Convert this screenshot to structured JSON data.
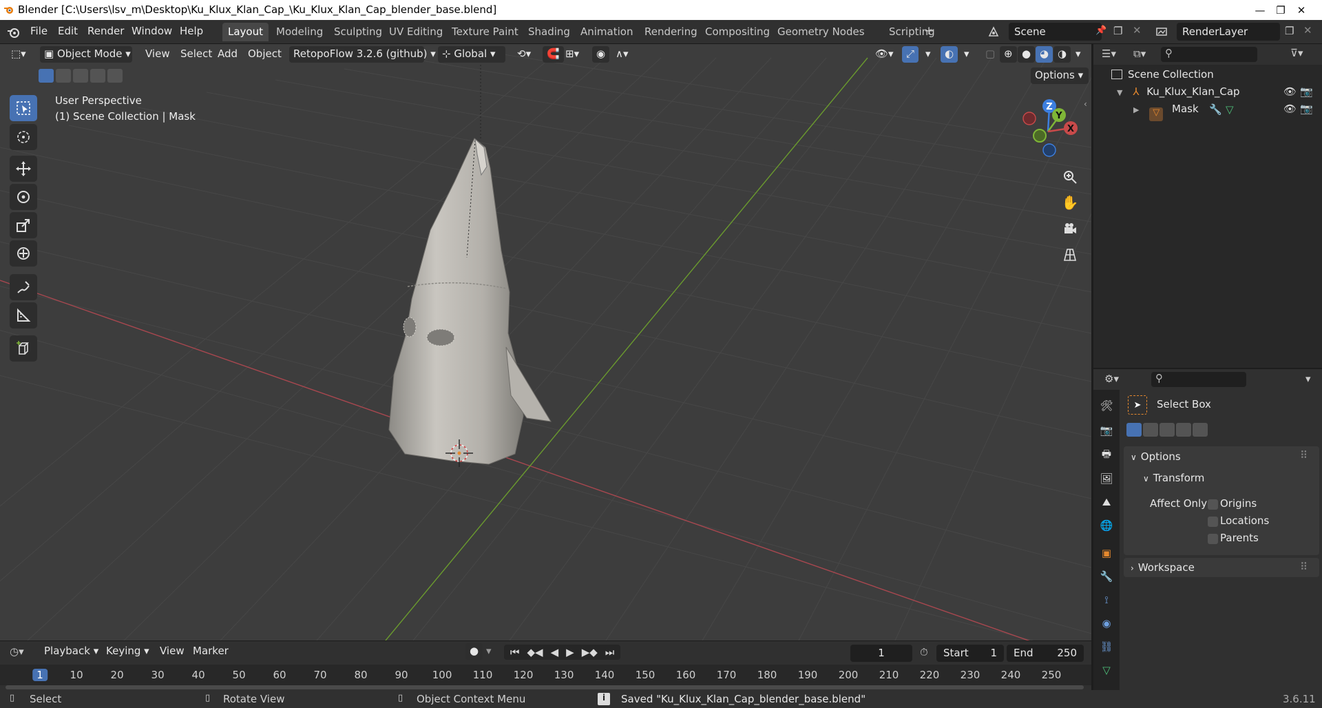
{
  "window": {
    "title": "Blender [C:\\Users\\lsv_m\\Desktop\\Ku_Klux_Klan_Cap_\\Ku_Klux_Klan_Cap_blender_base.blend]",
    "minimize": "—",
    "maximize": "❐",
    "close": "✕"
  },
  "menus": [
    "File",
    "Edit",
    "Render",
    "Window",
    "Help"
  ],
  "workspaces": [
    "Layout",
    "Modeling",
    "Sculpting",
    "UV Editing",
    "Texture Paint",
    "Shading",
    "Animation",
    "Rendering",
    "Compositing",
    "Geometry Nodes",
    "Scripting",
    "+"
  ],
  "active_workspace": "Layout",
  "scene": {
    "name": "Scene",
    "render_layer": "RenderLayer"
  },
  "viewport": {
    "mode": "Object Mode",
    "menus": [
      "View",
      "Select",
      "Add",
      "Object"
    ],
    "addon": "RetopoFlow 3.2.6 (github)",
    "orientation": "Global",
    "options": "Options",
    "perspective": "User Perspective",
    "collection_info": "(1) Scene Collection | Mask",
    "gizmo": {
      "x": "X",
      "y": "Y",
      "z": "Z"
    }
  },
  "tools": [
    "select-box",
    "cursor",
    "move",
    "rotate",
    "scale",
    "transform",
    "annotate",
    "measure",
    "add-cube"
  ],
  "outliner": {
    "root": "Scene Collection",
    "items": [
      {
        "name": "Ku_Klux_Klan_Cap",
        "type": "empty"
      },
      {
        "name": "Mask",
        "type": "mesh"
      }
    ]
  },
  "properties": {
    "tool_name": "Select Box",
    "options_label": "Options",
    "transform_label": "Transform",
    "affect_only_label": "Affect Only",
    "checkboxes": [
      "Origins",
      "Locations",
      "Parents"
    ],
    "workspace_label": "Workspace"
  },
  "timeline": {
    "menus": [
      "Playback",
      "Keying",
      "View",
      "Marker"
    ],
    "current_frame": "1",
    "start_label": "Start",
    "start": "1",
    "end_label": "End",
    "end": "250",
    "frame_ticks": [
      "1",
      "10",
      "20",
      "30",
      "40",
      "50",
      "60",
      "70",
      "80",
      "90",
      "100",
      "110",
      "120",
      "130",
      "140",
      "150",
      "160",
      "170",
      "180",
      "190",
      "200",
      "210",
      "220",
      "230",
      "240",
      "250"
    ]
  },
  "statusbar": {
    "select": "Select",
    "rotate": "Rotate View",
    "context": "Object Context Menu",
    "message": "Saved \"Ku_Klux_Klan_Cap_blender_base.blend\"",
    "version": "3.6.11"
  },
  "colors": {
    "accent": "#4772b3",
    "x_axis": "#c84a4a",
    "y_axis": "#7fb637",
    "z_axis": "#3d7fe0",
    "object_orange": "#e6892e"
  }
}
